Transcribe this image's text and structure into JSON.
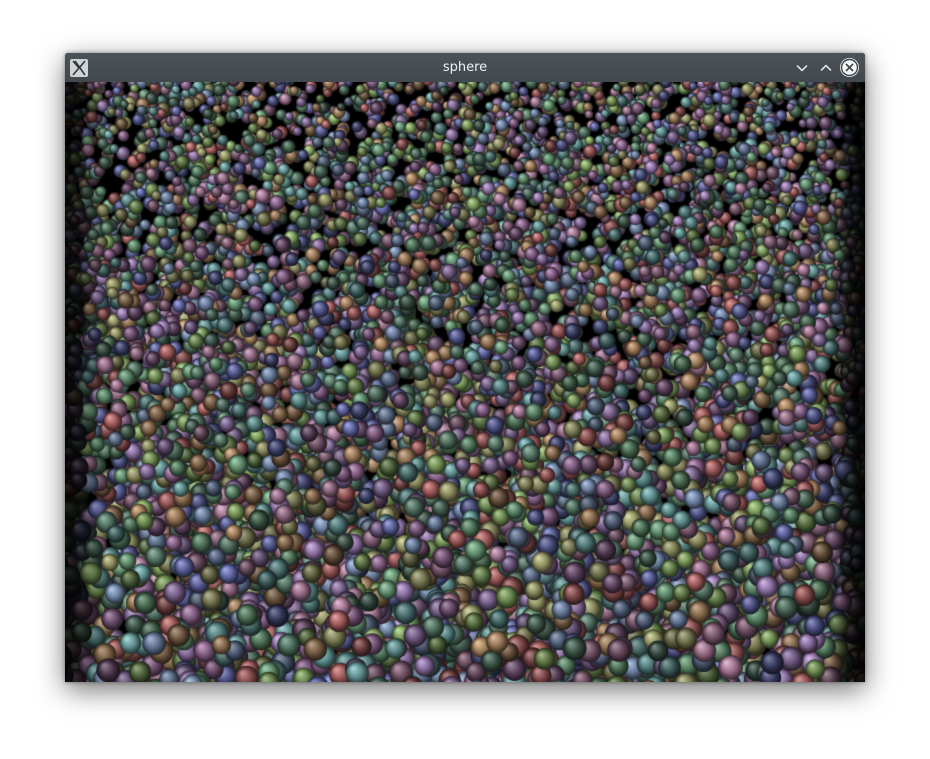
{
  "window": {
    "title": "sphere",
    "app_icon": "x-window-icon",
    "buttons": {
      "minimize": "chevron-down-icon",
      "maximize": "chevron-up-icon",
      "close": "close-icon"
    }
  },
  "scene": {
    "description_visible": false,
    "background_color": "#000000",
    "palette": [
      "#8a6fa0",
      "#5e8a6a",
      "#6a7e9e",
      "#9c7a58",
      "#7f5a80",
      "#5f8f8f",
      "#8f9060",
      "#a05a5a",
      "#5a5f9a",
      "#7a9a5a",
      "#9a6f8a",
      "#4f6f5f"
    ]
  }
}
